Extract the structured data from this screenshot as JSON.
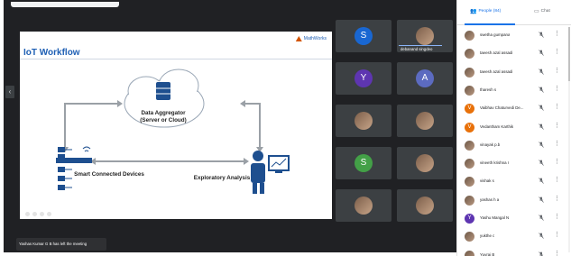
{
  "slide": {
    "title": "IoT Workflow",
    "brand": "MathWorks",
    "cloud_line1": "Data Aggregator",
    "cloud_line2": "(Server or Cloud)",
    "devices_label": "Smart Connected Devices",
    "analysis_label": "Exploratory Analysis",
    "dots": [
      1,
      2,
      3,
      4
    ]
  },
  "tiles": [
    {
      "initial": "S",
      "color": "#1967d2",
      "photo": false,
      "name": ""
    },
    {
      "initial": "",
      "color": "",
      "photo": true,
      "name": "debanand singdeo"
    },
    {
      "initial": "Y",
      "color": "#5e35b1",
      "photo": false,
      "name": ""
    },
    {
      "initial": "A",
      "color": "#5c6bc0",
      "photo": false,
      "name": ""
    },
    {
      "initial": "",
      "color": "",
      "photo": true,
      "name": ""
    },
    {
      "initial": "",
      "color": "",
      "photo": true,
      "name": ""
    },
    {
      "initial": "S",
      "color": "#43a047",
      "photo": false,
      "name": ""
    },
    {
      "initial": "",
      "color": "",
      "photo": true,
      "name": ""
    },
    {
      "initial": "",
      "color": "",
      "photo": true,
      "name": ""
    },
    {
      "initial": "",
      "color": "",
      "photo": true,
      "name": ""
    }
  ],
  "toast": "Yashas Kumar G B has left the meeting",
  "panel": {
    "people_tab": "People (84)",
    "chat_tab": "Chat",
    "participants": [
      {
        "name": "swetha gumpana",
        "initial": "",
        "color": ""
      },
      {
        "name": "taeesh azal assadi",
        "initial": "",
        "color": ""
      },
      {
        "name": "taeesh azal assadi",
        "initial": "",
        "color": ""
      },
      {
        "name": "tharesh s",
        "initial": "",
        "color": ""
      },
      {
        "name": "Vaibhav Chaturvedi De...",
        "initial": "V",
        "color": "#e8710a"
      },
      {
        "name": "Vedantham Karthik",
        "initial": "V",
        "color": "#e8710a"
      },
      {
        "name": "vinayak p.b",
        "initial": "",
        "color": ""
      },
      {
        "name": "vineeth krishna r",
        "initial": "",
        "color": ""
      },
      {
        "name": "vishak s",
        "initial": "",
        "color": ""
      },
      {
        "name": "yashas h a",
        "initial": "",
        "color": ""
      },
      {
        "name": "Yashu Mangal N",
        "initial": "Y",
        "color": "#5e35b1"
      },
      {
        "name": "yukthe c",
        "initial": "",
        "color": ""
      },
      {
        "name": "Yuvraj B",
        "initial": "",
        "color": ""
      }
    ]
  }
}
